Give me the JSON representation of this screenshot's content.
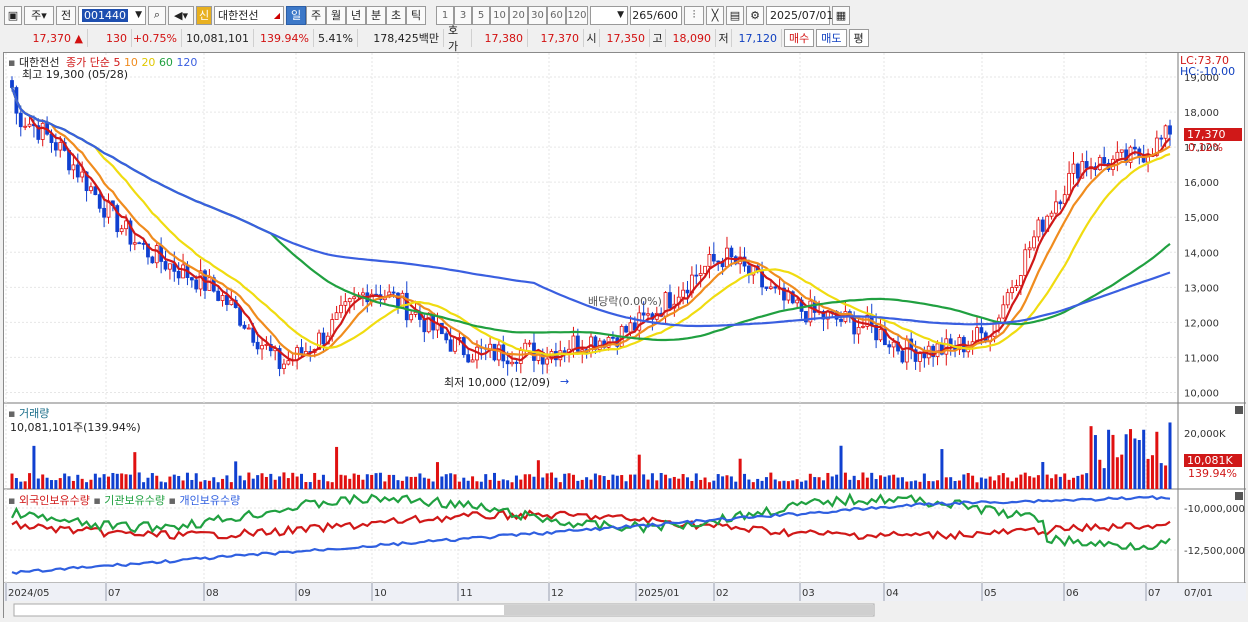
{
  "toolbar": {
    "market": "주",
    "prev": "전",
    "code": "001440",
    "new_label": "신",
    "name": "대한전선",
    "periods": [
      "일",
      "주",
      "월",
      "년",
      "분",
      "초",
      "틱"
    ],
    "active_period": "일",
    "intervals": [
      "1",
      "3",
      "5",
      "10",
      "20",
      "30",
      "60",
      "120"
    ],
    "count": "265",
    "count_total": "/600",
    "date": "2025/07/01"
  },
  "quote": {
    "price": "17,370",
    "arrow": "▲",
    "change": "130",
    "change_pct": "+0.75%",
    "volume": "10,081,101",
    "volume_ratio": "139.94%",
    "turnover": "5.41%",
    "amount": "178,425백만",
    "hoga_label": "호가",
    "ask": "17,380",
    "bid": "17,370",
    "open_label": "시",
    "open": "17,350",
    "high_label": "고",
    "high": "18,090",
    "low_label": "저",
    "low": "17,120",
    "buy_button": "매수",
    "sell_button": "매도",
    "eval_button": "평"
  },
  "price_pane": {
    "stock_name": "대한전선",
    "ma_title": "종가 단순",
    "ma_periods": [
      "5",
      "10",
      "20",
      "60",
      "120"
    ],
    "ma_colors": [
      "#d01818",
      "#f08c1e",
      "#f0dc10",
      "#20a040",
      "#3a5fe0"
    ],
    "high_note": "최고 19,300 (05/28)",
    "low_note": "최저 10,000 (12/09)",
    "dividend_note": "배당락(0.00%)",
    "lc": "LC:73.70",
    "hc": "HC:-10.00",
    "current": "17,370",
    "current_pct": "0.12%",
    "y_ticks": [
      "19,000",
      "18,000",
      "17,000",
      "16,000",
      "15,000",
      "14,000",
      "13,000",
      "12,000",
      "11,000",
      "10,000"
    ]
  },
  "volume_pane": {
    "title": "거래량",
    "value": "10,081,101주(139.94%)",
    "y_tick": "20,000K",
    "current": "10,081K",
    "current_pct": "139.94%"
  },
  "holdings_pane": {
    "series": [
      "외국인보유수량",
      "기관보유수량",
      "개인보유수량"
    ],
    "colors": [
      "#d01818",
      "#20a040",
      "#2f5fe0"
    ],
    "y_ticks": [
      "-10,000,000",
      "-12,500,000"
    ]
  },
  "x_axis": {
    "labels": [
      "2024/05",
      "07",
      "08",
      "09",
      "10",
      "11",
      "12",
      "2025/01",
      "02",
      "03",
      "04",
      "05",
      "06",
      "07"
    ],
    "right_label": "07/01"
  },
  "chart_data": {
    "type": "candlestick",
    "period": "daily",
    "x_range": [
      "2024/05",
      "2025/07/01"
    ],
    "y_range": [
      10000,
      19300
    ],
    "markers": [
      {
        "label": "최고",
        "value": 19300,
        "date": "05/28"
      },
      {
        "label": "최저",
        "value": 10000,
        "date": "12/09"
      }
    ],
    "last_close": 17370,
    "approx_closes_by_month": [
      {
        "month": "2024/05",
        "close": 18000
      },
      {
        "month": "07",
        "close": 15500
      },
      {
        "month": "08",
        "close": 13200
      },
      {
        "month": "09",
        "close": 11000
      },
      {
        "month": "10",
        "close": 12700
      },
      {
        "month": "11",
        "close": 11600
      },
      {
        "month": "12",
        "close": 10800
      },
      {
        "month": "2025/01",
        "close": 12200
      },
      {
        "month": "02",
        "close": 13600
      },
      {
        "month": "03",
        "close": 12500
      },
      {
        "month": "04",
        "close": 11000
      },
      {
        "month": "05",
        "close": 12000
      },
      {
        "month": "06",
        "close": 16500
      },
      {
        "month": "07",
        "close": 17370
      }
    ]
  }
}
